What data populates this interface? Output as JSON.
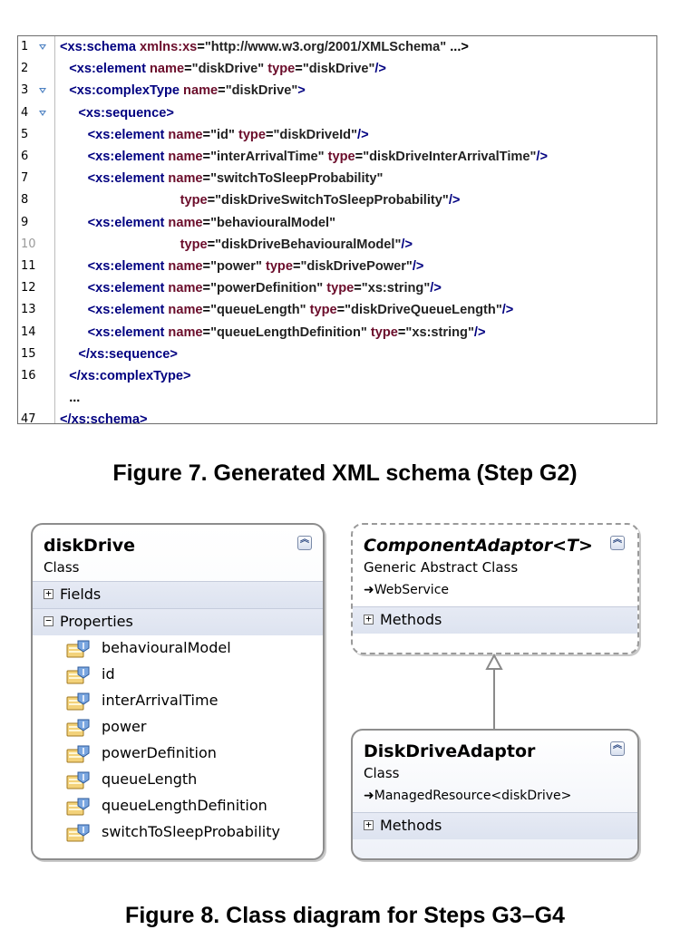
{
  "code": {
    "lines": [
      {
        "num": "1",
        "fold": true,
        "indent": 0,
        "parts": [
          {
            "c": "t-tag",
            "t": "<xs:schema "
          },
          {
            "c": "t-attr",
            "t": "xmlns:xs"
          },
          {
            "c": "t-plain",
            "t": "="
          },
          {
            "c": "t-val",
            "t": "\"http://www.w3.org/2001/XMLSchema\""
          },
          {
            "c": "t-plain",
            "t": " ...>"
          }
        ]
      },
      {
        "num": "2",
        "fold": false,
        "indent": 1,
        "parts": [
          {
            "c": "t-tag",
            "t": "<xs:element "
          },
          {
            "c": "t-attr",
            "t": "name"
          },
          {
            "c": "t-plain",
            "t": "="
          },
          {
            "c": "t-val",
            "t": "\"diskDrive\" "
          },
          {
            "c": "t-attr",
            "t": "type"
          },
          {
            "c": "t-plain",
            "t": "="
          },
          {
            "c": "t-val",
            "t": "\"diskDrive\""
          },
          {
            "c": "t-tag",
            "t": "/>"
          }
        ]
      },
      {
        "num": "3",
        "fold": true,
        "indent": 1,
        "parts": [
          {
            "c": "t-tag",
            "t": "<xs:complexType "
          },
          {
            "c": "t-attr",
            "t": "name"
          },
          {
            "c": "t-plain",
            "t": "="
          },
          {
            "c": "t-val",
            "t": "\"diskDrive\""
          },
          {
            "c": "t-tag",
            "t": ">"
          }
        ]
      },
      {
        "num": "4",
        "fold": true,
        "indent": 2,
        "parts": [
          {
            "c": "t-tag",
            "t": "<xs:sequence>"
          }
        ]
      },
      {
        "num": "5",
        "fold": false,
        "indent": 3,
        "parts": [
          {
            "c": "t-tag",
            "t": "<xs:element "
          },
          {
            "c": "t-attr",
            "t": "name"
          },
          {
            "c": "t-plain",
            "t": "="
          },
          {
            "c": "t-val",
            "t": "\"id\" "
          },
          {
            "c": "t-attr",
            "t": "type"
          },
          {
            "c": "t-plain",
            "t": "="
          },
          {
            "c": "t-val",
            "t": "\"diskDriveId\""
          },
          {
            "c": "t-tag",
            "t": "/>"
          }
        ]
      },
      {
        "num": "6",
        "fold": false,
        "indent": 3,
        "parts": [
          {
            "c": "t-tag",
            "t": "<xs:element "
          },
          {
            "c": "t-attr",
            "t": "name"
          },
          {
            "c": "t-plain",
            "t": "="
          },
          {
            "c": "t-val",
            "t": "\"interArrivalTime\" "
          },
          {
            "c": "t-attr",
            "t": "type"
          },
          {
            "c": "t-plain",
            "t": "="
          },
          {
            "c": "t-val",
            "t": "\"diskDriveInterArrivalTime\""
          },
          {
            "c": "t-tag",
            "t": "/>"
          }
        ]
      },
      {
        "num": "7",
        "fold": false,
        "indent": 3,
        "parts": [
          {
            "c": "t-tag",
            "t": "<xs:element "
          },
          {
            "c": "t-attr",
            "t": "name"
          },
          {
            "c": "t-plain",
            "t": "="
          },
          {
            "c": "t-val",
            "t": "\"switchToSleepProbability\""
          }
        ]
      },
      {
        "num": "8",
        "fold": false,
        "indent": 13,
        "parts": [
          {
            "c": "t-attr",
            "t": "type"
          },
          {
            "c": "t-plain",
            "t": "="
          },
          {
            "c": "t-val",
            "t": "\"diskDriveSwitchToSleepProbability\""
          },
          {
            "c": "t-tag",
            "t": "/>"
          }
        ]
      },
      {
        "num": "9",
        "fold": false,
        "indent": 3,
        "parts": [
          {
            "c": "t-tag",
            "t": "<xs:element "
          },
          {
            "c": "t-attr",
            "t": "name"
          },
          {
            "c": "t-plain",
            "t": "="
          },
          {
            "c": "t-val",
            "t": "\"behaviouralModel\""
          }
        ]
      },
      {
        "num": "10",
        "fold": false,
        "grey": true,
        "indent": 13,
        "parts": [
          {
            "c": "t-attr",
            "t": "type"
          },
          {
            "c": "t-plain",
            "t": "="
          },
          {
            "c": "t-val",
            "t": "\"diskDriveBehaviouralModel\""
          },
          {
            "c": "t-tag",
            "t": "/>"
          }
        ]
      },
      {
        "num": "11",
        "fold": false,
        "indent": 3,
        "parts": [
          {
            "c": "t-tag",
            "t": "<xs:element "
          },
          {
            "c": "t-attr",
            "t": "name"
          },
          {
            "c": "t-plain",
            "t": "="
          },
          {
            "c": "t-val",
            "t": "\"power\" "
          },
          {
            "c": "t-attr",
            "t": "type"
          },
          {
            "c": "t-plain",
            "t": "="
          },
          {
            "c": "t-val",
            "t": "\"diskDrivePower\""
          },
          {
            "c": "t-tag",
            "t": "/>"
          }
        ]
      },
      {
        "num": "12",
        "fold": false,
        "indent": 3,
        "parts": [
          {
            "c": "t-tag",
            "t": "<xs:element "
          },
          {
            "c": "t-attr",
            "t": "name"
          },
          {
            "c": "t-plain",
            "t": "="
          },
          {
            "c": "t-val",
            "t": "\"powerDefinition\" "
          },
          {
            "c": "t-attr",
            "t": "type"
          },
          {
            "c": "t-plain",
            "t": "="
          },
          {
            "c": "t-val",
            "t": "\"xs:string\""
          },
          {
            "c": "t-tag",
            "t": "/>"
          }
        ]
      },
      {
        "num": "13",
        "fold": false,
        "indent": 3,
        "parts": [
          {
            "c": "t-tag",
            "t": "<xs:element "
          },
          {
            "c": "t-attr",
            "t": "name"
          },
          {
            "c": "t-plain",
            "t": "="
          },
          {
            "c": "t-val",
            "t": "\"queueLength\" "
          },
          {
            "c": "t-attr",
            "t": "type"
          },
          {
            "c": "t-plain",
            "t": "="
          },
          {
            "c": "t-val",
            "t": "\"diskDriveQueueLength\""
          },
          {
            "c": "t-tag",
            "t": "/>"
          }
        ]
      },
      {
        "num": "14",
        "fold": false,
        "indent": 3,
        "parts": [
          {
            "c": "t-tag",
            "t": "<xs:element "
          },
          {
            "c": "t-attr",
            "t": "name"
          },
          {
            "c": "t-plain",
            "t": "="
          },
          {
            "c": "t-val",
            "t": "\"queueLengthDefinition\" "
          },
          {
            "c": "t-attr",
            "t": "type"
          },
          {
            "c": "t-plain",
            "t": "="
          },
          {
            "c": "t-val",
            "t": "\"xs:string\""
          },
          {
            "c": "t-tag",
            "t": "/>"
          }
        ]
      },
      {
        "num": "15",
        "fold": false,
        "indent": 2,
        "parts": [
          {
            "c": "t-tag",
            "t": "</xs:sequence>"
          }
        ]
      },
      {
        "num": "16",
        "fold": false,
        "indent": 1,
        "parts": [
          {
            "c": "t-tag",
            "t": "</xs:complexType>"
          }
        ]
      },
      {
        "num": "",
        "fold": false,
        "indent": 1,
        "parts": [
          {
            "c": "t-plain",
            "t": "..."
          }
        ]
      },
      {
        "num": "47",
        "fold": false,
        "indent": 0,
        "parts": [
          {
            "c": "t-tag",
            "t": "</xs:schema>"
          }
        ]
      }
    ]
  },
  "captions": {
    "fig7": "Figure 7. Generated XML schema (Step G2)",
    "fig8": "Figure 8. Class diagram for Steps G3–G4"
  },
  "diagram": {
    "diskDrive": {
      "name": "diskDrive",
      "stereotype": "Class",
      "fields_label": "Fields",
      "properties_label": "Properties",
      "properties": [
        "behaviouralModel",
        "id",
        "interArrivalTime",
        "power",
        "powerDefinition",
        "queueLength",
        "queueLengthDefinition",
        "switchToSleepProbability"
      ]
    },
    "componentAdaptor": {
      "name": "ComponentAdaptor<T>",
      "stereotype": "Generic Abstract Class",
      "inherits": "WebService",
      "methods_label": "Methods"
    },
    "diskDriveAdaptor": {
      "name": "DiskDriveAdaptor",
      "stereotype": "Class",
      "inherits": "ManagedResource<diskDrive>",
      "methods_label": "Methods"
    }
  },
  "colors": {
    "tag": "#000080",
    "attr": "#6b0d2b",
    "fold": "#4a7fc1"
  }
}
